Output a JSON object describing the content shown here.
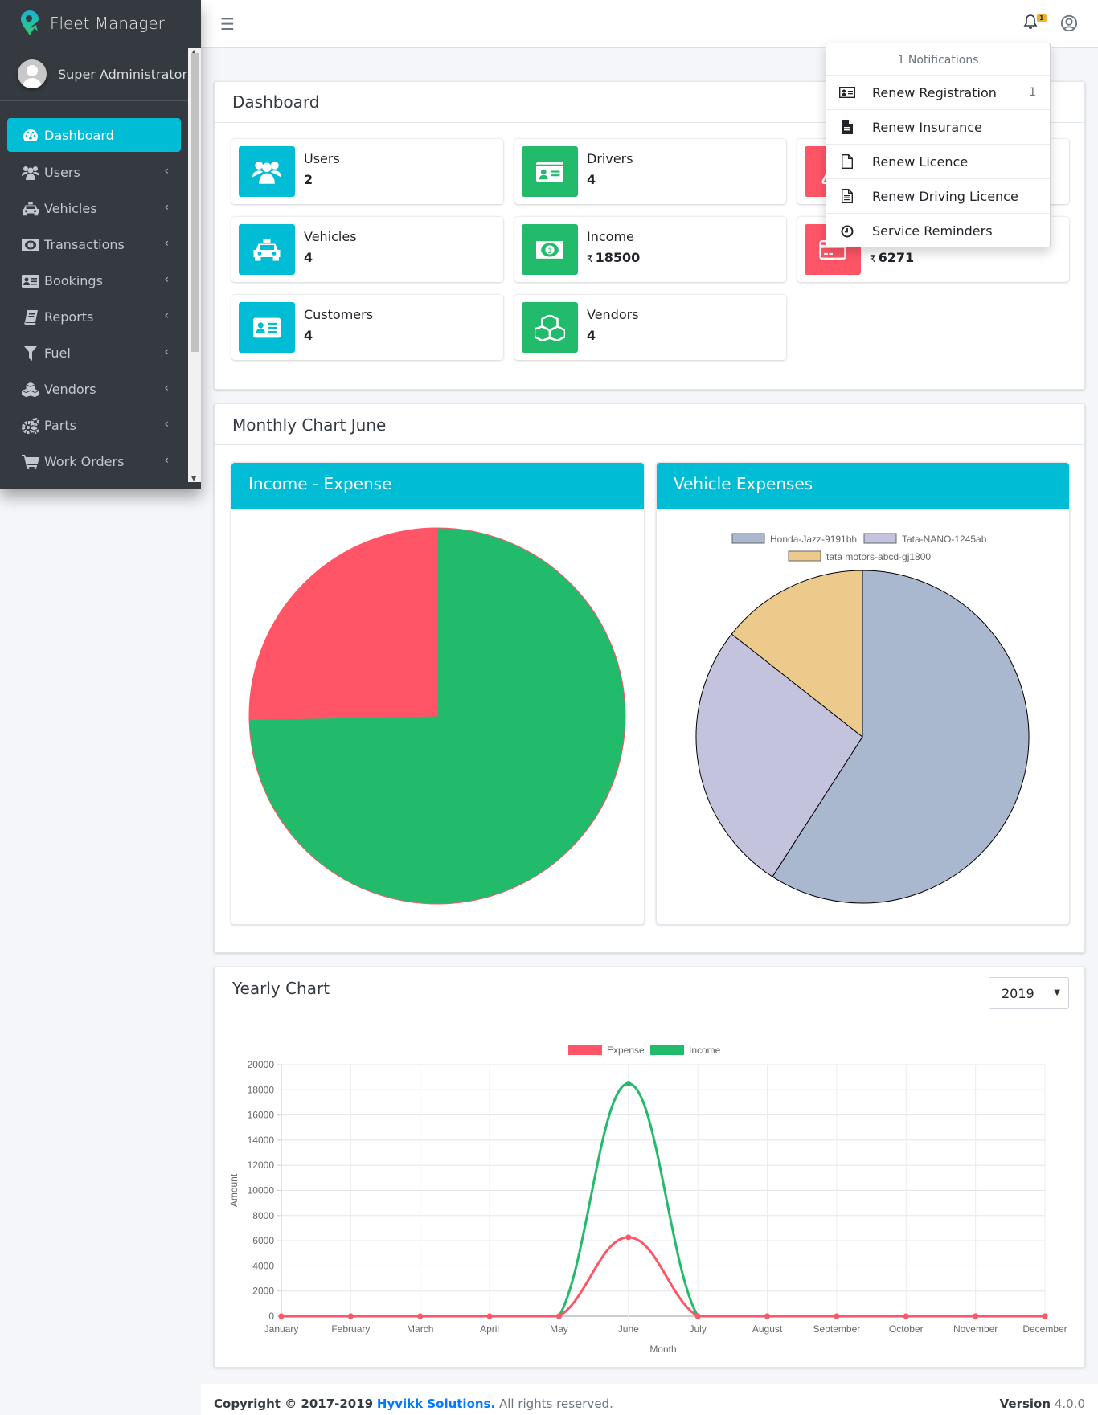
{
  "sidebar": {
    "brand": "Fleet Manager",
    "user": "Super Administrator",
    "items": [
      {
        "label": "Dashboard",
        "icon": "dashboard-icon",
        "active": true
      },
      {
        "label": "Users",
        "icon": "users-icon"
      },
      {
        "label": "Vehicles",
        "icon": "taxi-icon"
      },
      {
        "label": "Transactions",
        "icon": "money-icon"
      },
      {
        "label": "Bookings",
        "icon": "address-card-icon"
      },
      {
        "label": "Reports",
        "icon": "book-icon"
      },
      {
        "label": "Fuel",
        "icon": "filter-icon"
      },
      {
        "label": "Vendors",
        "icon": "cubes-icon"
      },
      {
        "label": "Parts",
        "icon": "cogs-icon"
      },
      {
        "label": "Work Orders",
        "icon": "cart-icon"
      }
    ]
  },
  "navbar": {
    "notification_count": "1"
  },
  "notifications": {
    "header": "1 Notifications",
    "items": [
      {
        "label": "Renew Registration",
        "count": "1",
        "icon": "id-card-icon"
      },
      {
        "label": "Renew Insurance",
        "count": "",
        "icon": "file-text-icon"
      },
      {
        "label": "Renew Licence",
        "count": "",
        "icon": "file-icon"
      },
      {
        "label": "Renew Driving Licence",
        "count": "",
        "icon": "file-alt-icon"
      },
      {
        "label": "Service Reminders",
        "count": "",
        "icon": "clock-icon"
      }
    ]
  },
  "dashboard": {
    "title": "Dashboard",
    "currency": "₹",
    "stats": [
      {
        "label": "Users",
        "value": "2",
        "color": "#00bcd4",
        "icon": "users-icon"
      },
      {
        "label": "Drivers",
        "value": "4",
        "color": "#22bb6b",
        "icon": "id-card-icon"
      },
      {
        "label": "",
        "value": "",
        "color": "#ff5566",
        "icon": "flask-icon"
      },
      {
        "label": "Vehicles",
        "value": "4",
        "color": "#00bcd4",
        "icon": "taxi-icon"
      },
      {
        "label": "Income",
        "value": "18500",
        "color": "#22bb6b",
        "icon": "money-icon"
      },
      {
        "label": "",
        "value": "6271",
        "color": "#ff5566",
        "icon": "credit-card-icon"
      },
      {
        "label": "Customers",
        "value": "4",
        "color": "#00bcd4",
        "icon": "address-card-icon"
      },
      {
        "label": "Vendors",
        "value": "4",
        "color": "#22bb6b",
        "icon": "cubes-icon"
      }
    ]
  },
  "monthly": {
    "title": "Monthly Chart June",
    "income_expense_title": "Income - Expense",
    "vehicle_expenses_title": "Vehicle Expenses"
  },
  "yearly": {
    "title": "Yearly Chart",
    "year": "2019"
  },
  "chart_data": [
    {
      "type": "pie",
      "title": "Income - Expense",
      "labels": [
        "Expense",
        "Income"
      ],
      "values": [
        6271,
        18500
      ],
      "colors": [
        "#ff5566",
        "#22bb6b"
      ]
    },
    {
      "type": "pie",
      "title": "Vehicle Expenses",
      "labels": [
        "Honda-Jazz-9191bh",
        "Tata-NANO-1245ab",
        "tata motors-abcd-gj1800"
      ],
      "values": [
        59.1,
        26.5,
        14.4
      ],
      "colors": [
        "#a9b7cf",
        "#c3c3de",
        "#ebca8b"
      ],
      "legend": "top"
    },
    {
      "type": "line",
      "title": "",
      "xlabel": "Month",
      "ylabel": "Amount",
      "categories": [
        "January",
        "February",
        "March",
        "April",
        "May",
        "June",
        "July",
        "August",
        "September",
        "October",
        "November",
        "December"
      ],
      "series": [
        {
          "name": "Expense",
          "color": "#ff5566",
          "values": [
            0,
            0,
            0,
            0,
            0,
            6271,
            0,
            0,
            0,
            0,
            0,
            0
          ]
        },
        {
          "name": "Income",
          "color": "#22bb6b",
          "values": [
            0,
            0,
            0,
            0,
            0,
            18500,
            0,
            0,
            0,
            0,
            0,
            0
          ]
        }
      ],
      "ylim": [
        0,
        20000
      ],
      "yticks": [
        0,
        2000,
        4000,
        6000,
        8000,
        10000,
        12000,
        14000,
        16000,
        18000,
        20000
      ],
      "grid": true,
      "legend": "top"
    }
  ],
  "footer": {
    "copyright": "Copyright © 2017-2019",
    "company": "Hyvikk Solutions.",
    "rights": "All rights reserved.",
    "version_label": "Version",
    "version": "4.0.0"
  }
}
